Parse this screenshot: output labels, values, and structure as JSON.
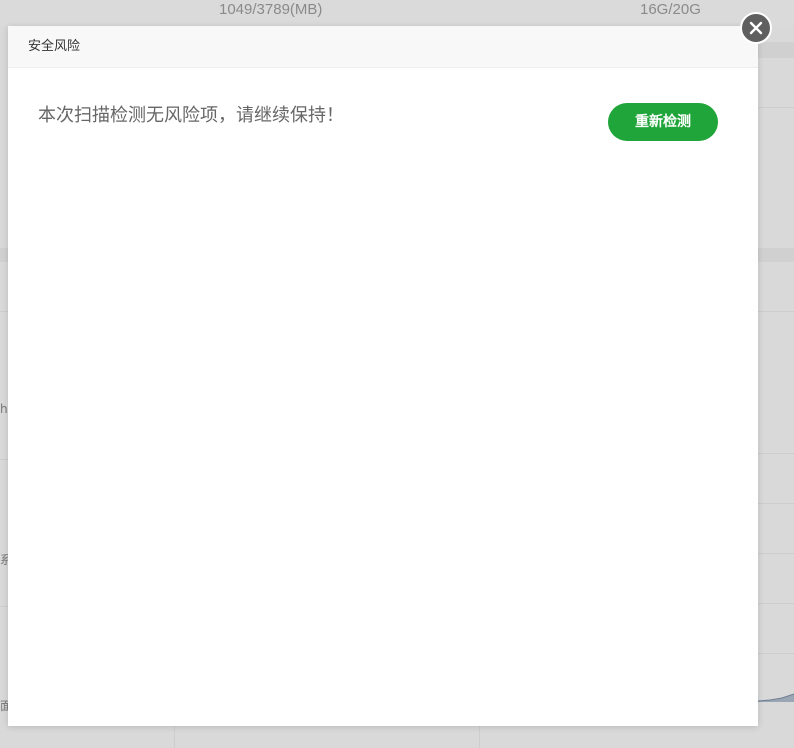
{
  "background": {
    "memory_usage": "1049/3789(MB)",
    "disk_usage": "16G/20G",
    "edge_chars": [
      "h",
      "系",
      "面"
    ]
  },
  "modal": {
    "title": "安全风险",
    "message": "本次扫描检测无风险项，请继续保持！",
    "recheck_button_label": "重新检测",
    "close_icon": "close-icon"
  },
  "colors": {
    "accent_green": "#20a53a",
    "overlay": "#d9d9d9"
  }
}
